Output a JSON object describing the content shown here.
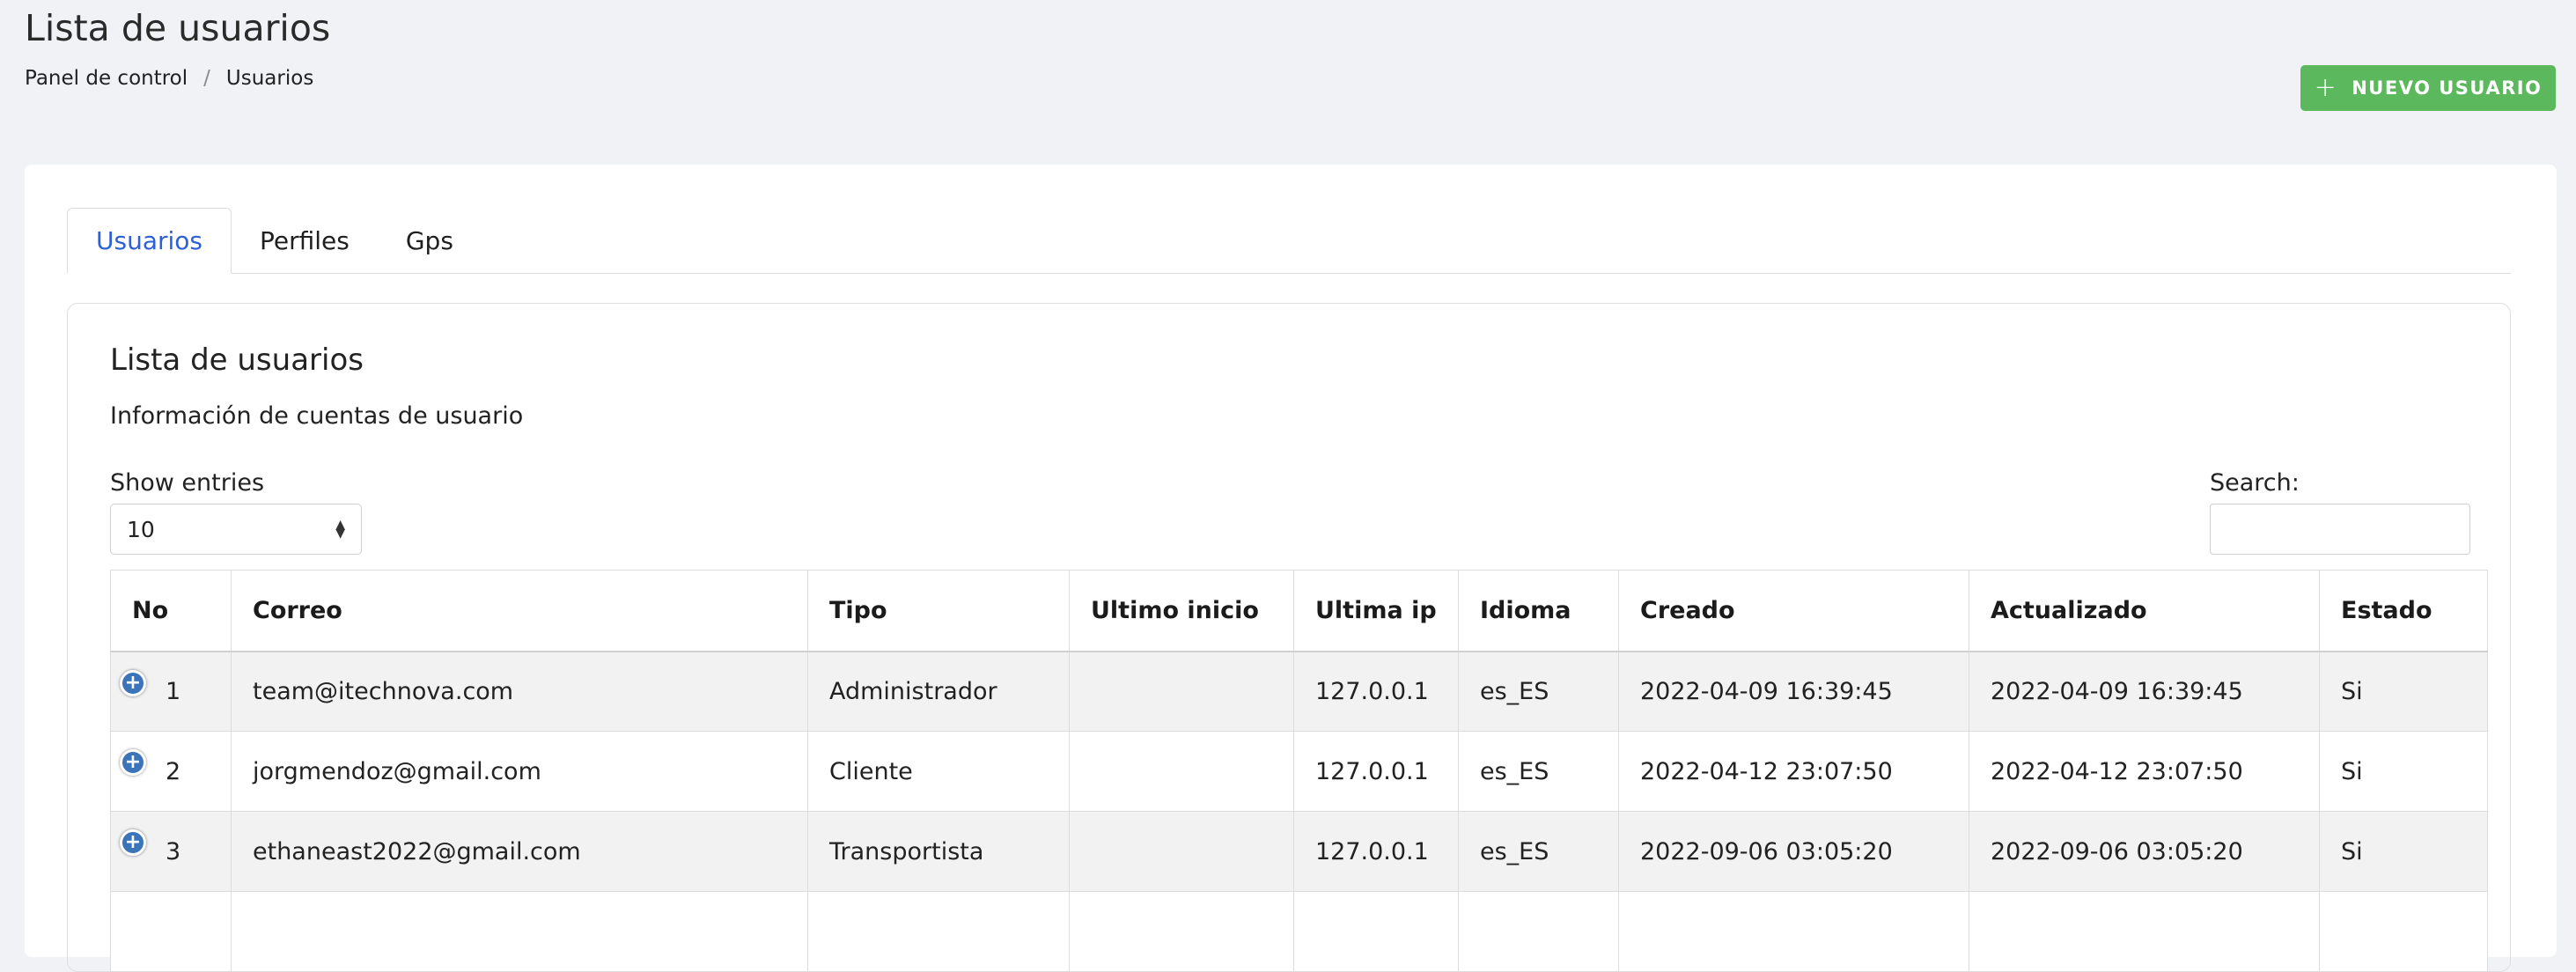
{
  "header": {
    "title": "Lista de usuarios",
    "breadcrumb": [
      {
        "label": "Panel de control"
      },
      {
        "label": "Usuarios"
      }
    ],
    "breadcrumb_separator": "/",
    "new_user_button": {
      "icon": "plus-icon",
      "label": "NUEVO USUARIO",
      "color": "#5cb85c"
    }
  },
  "tabs": [
    {
      "label": "Usuarios",
      "active": true
    },
    {
      "label": "Perfiles",
      "active": false
    },
    {
      "label": "Gps",
      "active": false
    }
  ],
  "panel": {
    "title": "Lista de usuarios",
    "subtitle": "Información de cuentas de usuario",
    "show_entries_label": "Show entries",
    "entries_value": "10",
    "search_label": "Search:",
    "search_value": ""
  },
  "table": {
    "columns": [
      "No",
      "Correo",
      "Tipo",
      "Ultimo inicio",
      "Ultima ip",
      "Idioma",
      "Creado",
      "Actualizado",
      "Estado"
    ],
    "rows": [
      {
        "no": "1",
        "correo": "team@itechnova.com",
        "tipo": "Administrador",
        "ultimo_inicio": "",
        "ultima_ip": "127.0.0.1",
        "idioma": "es_ES",
        "creado": "2022-04-09 16:39:45",
        "actualizado": "2022-04-09 16:39:45",
        "estado": "Si"
      },
      {
        "no": "2",
        "correo": "jorgmendoz@gmail.com",
        "tipo": "Cliente",
        "ultimo_inicio": "",
        "ultima_ip": "127.0.0.1",
        "idioma": "es_ES",
        "creado": "2022-04-12 23:07:50",
        "actualizado": "2022-04-12 23:07:50",
        "estado": "Si"
      },
      {
        "no": "3",
        "correo": "ethaneast2022@gmail.com",
        "tipo": "Transportista",
        "ultimo_inicio": "",
        "ultima_ip": "127.0.0.1",
        "idioma": "es_ES",
        "creado": "2022-09-06 03:05:20",
        "actualizado": "2022-09-06 03:05:20",
        "estado": "Si"
      }
    ]
  },
  "colors": {
    "background": "#f1f2f6",
    "active_tab": "#2d5fd8",
    "expand_button": "#3b74b8"
  }
}
